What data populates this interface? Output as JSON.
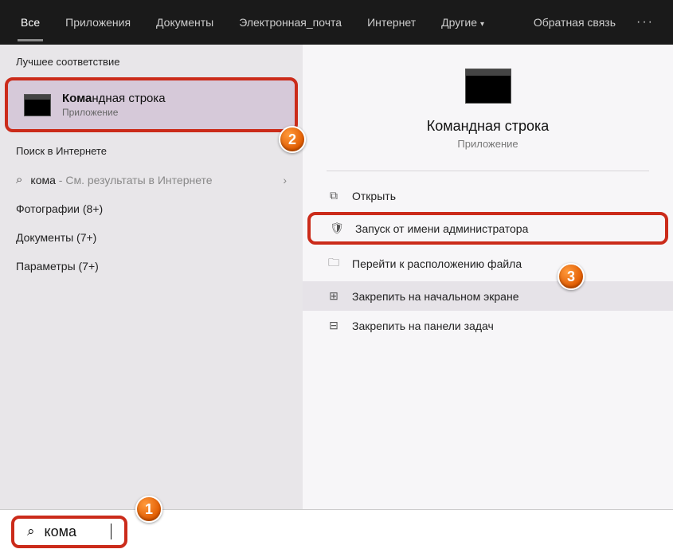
{
  "header": {
    "tabs": [
      "Все",
      "Приложения",
      "Документы",
      "Электронная_почта",
      "Интернет",
      "Другие"
    ],
    "active_tab": 0,
    "feedback": "Обратная связь",
    "more": "···"
  },
  "left": {
    "best_match_header": "Лучшее соответствие",
    "best_match": {
      "title_bold": "Кома",
      "title_rest": "ндная строка",
      "subtitle": "Приложение"
    },
    "web_search_header": "Поиск в Интернете",
    "web_item": {
      "query": "кома",
      "suffix": " - См. результаты в Интернете"
    },
    "categories": [
      "Фотографии (8+)",
      "Документы (7+)",
      "Параметры (7+)"
    ]
  },
  "right": {
    "title": "Командная строка",
    "subtitle": "Приложение",
    "actions": [
      {
        "icon": "open",
        "label": "Открыть"
      },
      {
        "icon": "admin",
        "label": "Запуск от имени администратора"
      },
      {
        "icon": "folder",
        "label": "Перейти к расположению файла"
      },
      {
        "icon": "pin-start",
        "label": "Закрепить на начальном экране"
      },
      {
        "icon": "pin-task",
        "label": "Закрепить на панели задач"
      }
    ]
  },
  "search": {
    "query": "кома"
  },
  "badges": {
    "b1": "1",
    "b2": "2",
    "b3": "3"
  },
  "icons": {
    "search": "⌕",
    "chevron_right": "›",
    "chevron_down": "▾",
    "open": "⧉",
    "admin": "🛡",
    "folder": "🗀",
    "pin_start": "⊞",
    "pin_task": "⊟"
  }
}
